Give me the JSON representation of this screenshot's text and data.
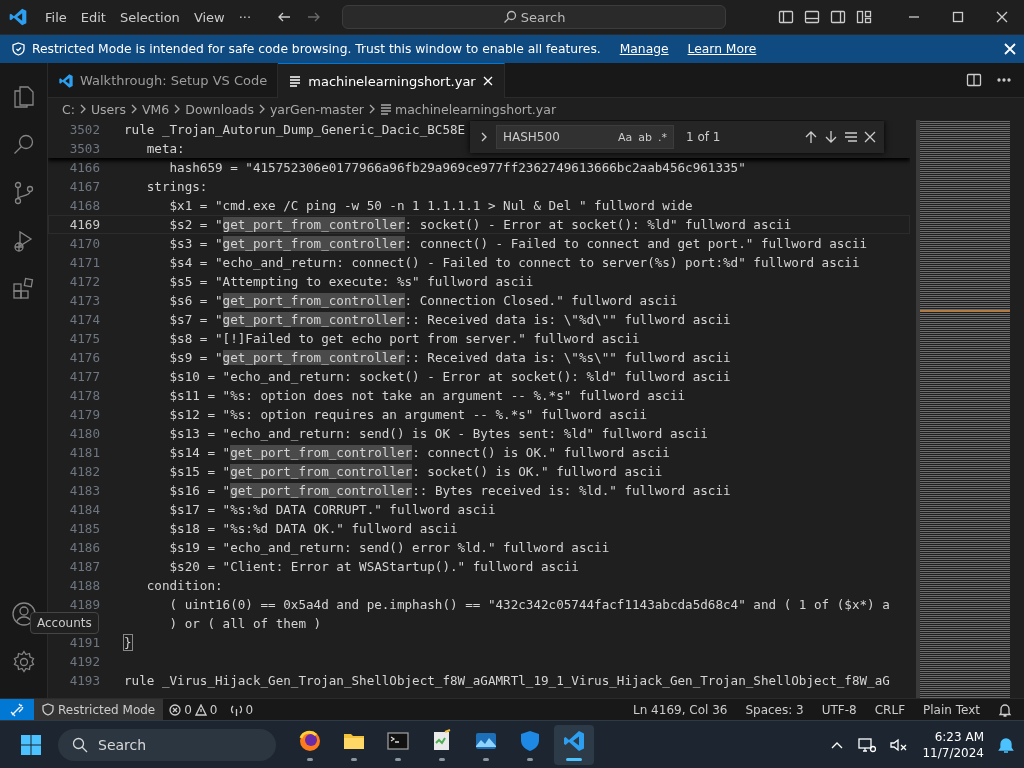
{
  "title_bar": {
    "menu": [
      "File",
      "Edit",
      "Selection",
      "View",
      "···"
    ],
    "search": {
      "placeholder": "Search"
    }
  },
  "banner": {
    "message": "Restricted Mode is intended for safe code browsing. Trust this window to enable all features.",
    "links": [
      "Manage",
      "Learn More"
    ]
  },
  "activity_bar": {
    "items": [
      {
        "kind": "explorer"
      },
      {
        "kind": "search"
      },
      {
        "kind": "source-control"
      },
      {
        "kind": "run-debug"
      },
      {
        "kind": "extensions"
      }
    ],
    "bottom": [
      {
        "kind": "accounts"
      },
      {
        "kind": "settings"
      }
    ],
    "tooltip": "Accounts"
  },
  "tabs": [
    {
      "label": "Walkthrough: Setup VS Code",
      "kind": "walkthrough",
      "selected": false
    },
    {
      "label": "machinelearningshort.yar",
      "kind": "file",
      "selected": true
    }
  ],
  "breadcrumbs": [
    "C:",
    "Users",
    "VM6",
    "Downloads",
    "yarGen-master",
    "machinelearningshort.yar"
  ],
  "find": {
    "value": "HASH500",
    "options": [
      "Aa",
      "ab",
      ".*"
    ],
    "result": "1 of 1"
  },
  "editor": {
    "sticky_lines": [
      {
        "number": "3502",
        "text": "rule _Trojan_Autorun_Dump_Generic_Dacic_BC58E"
      },
      {
        "number": "3503",
        "text": "   meta:"
      }
    ],
    "lines": [
      {
        "number": "4166",
        "current": false,
        "text": "      hash659 = \"415752306e0177966a96fb29a969ce977ff2362749613666bc2aab456c961335\""
      },
      {
        "number": "4167",
        "current": false,
        "text": "   strings:"
      },
      {
        "number": "4168",
        "current": false,
        "text": "      $x1 = \"cmd.exe /C ping -w 50 -n 1 1.1.1.1 > Nul & Del \" fullword wide"
      },
      {
        "number": "4169",
        "current": true,
        "segments": [
          {
            "kind": "plain",
            "text": "      $s2 = \""
          },
          {
            "kind": "match",
            "text": "get_port_from_controller"
          },
          {
            "kind": "plain",
            "text": ": socket() - Error at socket(): %ld\" fullword ascii"
          }
        ]
      },
      {
        "number": "4170",
        "current": false,
        "segments": [
          {
            "kind": "plain",
            "text": "      $s3 = \""
          },
          {
            "kind": "match",
            "text": "get_port_from_controller"
          },
          {
            "kind": "plain",
            "text": ": connect() - Failed to connect and get port.\" fullword ascii"
          }
        ]
      },
      {
        "number": "4171",
        "current": false,
        "text": "      $s4 = \"echo_and_return: connect() - Failed to connect to server(%s) port:%d\" fullword ascii"
      },
      {
        "number": "4172",
        "current": false,
        "text": "      $s5 = \"Attempting to execute: %s\" fullword ascii"
      },
      {
        "number": "4173",
        "current": false,
        "segments": [
          {
            "kind": "plain",
            "text": "      $s6 = \""
          },
          {
            "kind": "match",
            "text": "get_port_from_controller"
          },
          {
            "kind": "plain",
            "text": ": Connection Closed.\" fullword ascii"
          }
        ]
      },
      {
        "number": "4174",
        "current": false,
        "segments": [
          {
            "kind": "plain",
            "text": "      $s7 = \""
          },
          {
            "kind": "match",
            "text": "get_port_from_controller"
          },
          {
            "kind": "plain",
            "text": ":: Received data is: \\\"%d\\\"\" fullword ascii"
          }
        ]
      },
      {
        "number": "4175",
        "current": false,
        "text": "      $s8 = \"[!]Failed to get echo port from server.\" fullword ascii"
      },
      {
        "number": "4176",
        "current": false,
        "segments": [
          {
            "kind": "plain",
            "text": "      $s9 = \""
          },
          {
            "kind": "match",
            "text": "get_port_from_controller"
          },
          {
            "kind": "plain",
            "text": ":: Received data is: \\\"%s\\\"\" fullword ascii"
          }
        ]
      },
      {
        "number": "4177",
        "current": false,
        "text": "      $s10 = \"echo_and_return: socket() - Error at socket(): %ld\" fullword ascii"
      },
      {
        "number": "4178",
        "current": false,
        "text": "      $s11 = \"%s: option does not take an argument -- %.*s\" fullword ascii"
      },
      {
        "number": "4179",
        "current": false,
        "text": "      $s12 = \"%s: option requires an argument -- %.*s\" fullword ascii"
      },
      {
        "number": "4180",
        "current": false,
        "text": "      $s13 = \"echo_and_return: send() is OK - Bytes sent: %ld\" fullword ascii"
      },
      {
        "number": "4181",
        "current": false,
        "segments": [
          {
            "kind": "plain",
            "text": "      $s14 = \""
          },
          {
            "kind": "match",
            "text": "get_port_from_controller"
          },
          {
            "kind": "plain",
            "text": ": connect() is OK.\" fullword ascii"
          }
        ]
      },
      {
        "number": "4182",
        "current": false,
        "segments": [
          {
            "kind": "plain",
            "text": "      $s15 = \""
          },
          {
            "kind": "match",
            "text": "get_port_from_controller"
          },
          {
            "kind": "plain",
            "text": ": socket() is OK.\" fullword ascii"
          }
        ]
      },
      {
        "number": "4183",
        "current": false,
        "segments": [
          {
            "kind": "plain",
            "text": "      $s16 = \""
          },
          {
            "kind": "match",
            "text": "get_port_from_controller"
          },
          {
            "kind": "plain",
            "text": ":: Bytes received is: %ld.\" fullword ascii"
          }
        ]
      },
      {
        "number": "4184",
        "current": false,
        "text": "      $s17 = \"%s:%d DATA CORRUPT.\" fullword ascii"
      },
      {
        "number": "4185",
        "current": false,
        "text": "      $s18 = \"%s:%d DATA OK.\" fullword ascii"
      },
      {
        "number": "4186",
        "current": false,
        "text": "      $s19 = \"echo_and_return: send() error %ld.\" fullword ascii"
      },
      {
        "number": "4187",
        "current": false,
        "text": "      $s20 = \"Client: Error at WSAStartup().\" fullword ascii"
      },
      {
        "number": "4188",
        "current": false,
        "text": "   condition:"
      },
      {
        "number": "4189",
        "current": false,
        "text": "      ( uint16(0) == 0x5a4d and pe.imphash() == \"432c342c05744facf1143abcda5d68c4\" and ( 1 of ($x*) a"
      },
      {
        "current": false,
        "text": "      ) or ( all of them )"
      },
      {
        "number": "4191",
        "current": false,
        "segments": [
          {
            "kind": "bracket",
            "text": "}"
          }
        ]
      },
      {
        "number": "4192",
        "current": false
      },
      {
        "number": "4193",
        "current": false,
        "text": "rule _Virus_Hijack_Gen_Trojan_ShellObject_f8W_aGAMRTl_19_1_Virus_Hijack_Gen_Trojan_ShellObject_f8W_aG"
      }
    ]
  },
  "status_bar": {
    "mode": "Restricted Mode",
    "errors": "0",
    "warnings": "0",
    "ports": "0",
    "items": [
      "Ln 4169, Col 36",
      "Spaces: 3",
      "UTF-8",
      "CRLF",
      "Plain Text"
    ]
  },
  "taskbar": {
    "search": {
      "placeholder": "Search"
    },
    "apps": [
      {
        "kind": "firefox",
        "selected": false
      },
      {
        "kind": "folder",
        "selected": false
      },
      {
        "kind": "terminal",
        "selected": false
      },
      {
        "kind": "notepad",
        "selected": false
      },
      {
        "kind": "photos",
        "selected": false
      },
      {
        "kind": "shield",
        "selected": false
      },
      {
        "kind": "vscode",
        "selected": true
      }
    ],
    "time": "6:23 AM",
    "date": "11/7/2024"
  }
}
